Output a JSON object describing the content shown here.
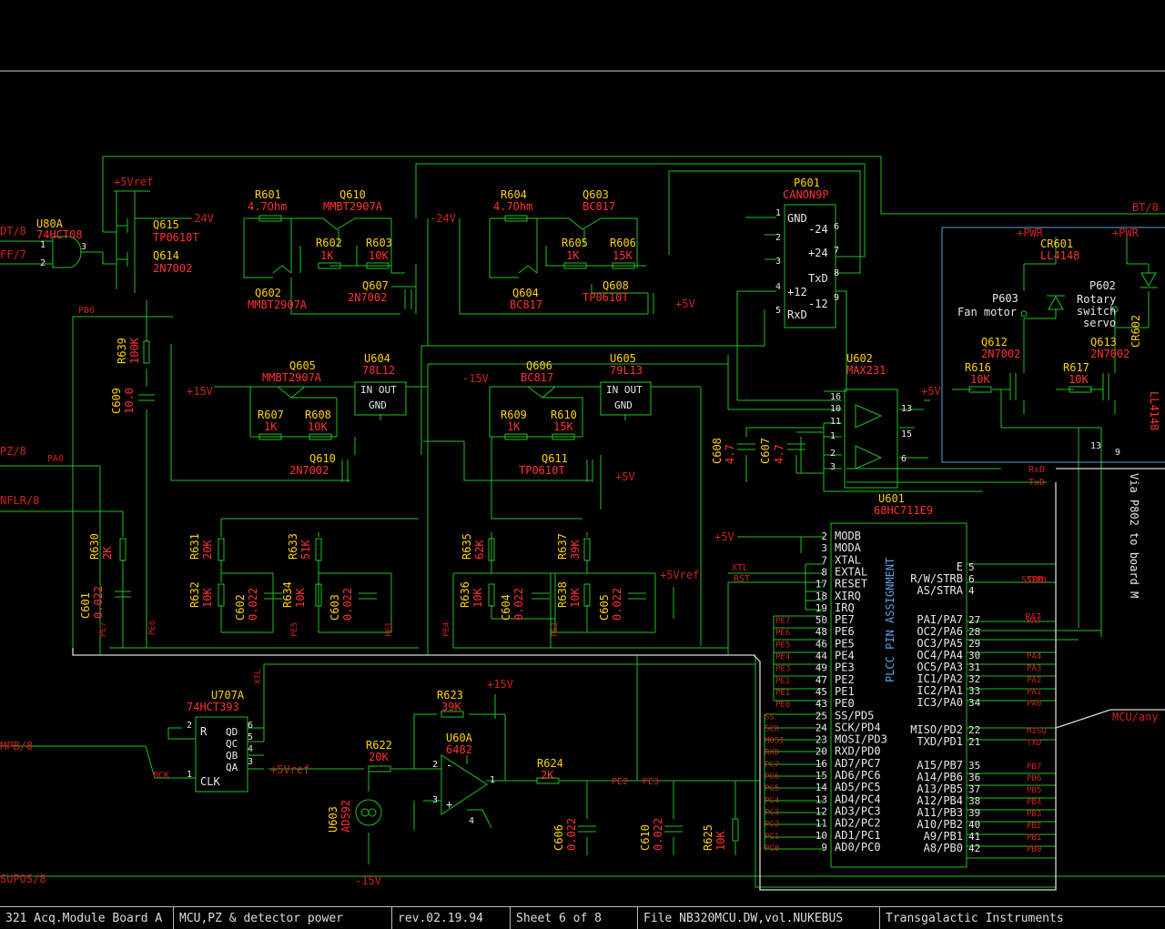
{
  "colors": {
    "wire": "#20c020",
    "ref": "#ffd000",
    "value": "#ff3030",
    "net": "#d02020",
    "text": "#e8e8e8",
    "part": "#e8e8e8",
    "blue": "#5aa0e0"
  },
  "components": [
    {
      "id": "U80A",
      "ref": "U80A",
      "value": "74HCT08"
    },
    {
      "id": "Q615",
      "ref": "Q615",
      "value": "TP0610T"
    },
    {
      "id": "Q614",
      "ref": "Q614",
      "value": "2N7002"
    },
    {
      "id": "R601",
      "ref": "R601",
      "value": "4.7Ohm"
    },
    {
      "id": "Q610a",
      "ref": "Q610",
      "value": "MMBT2907A"
    },
    {
      "id": "R602",
      "ref": "R602",
      "value": "1K"
    },
    {
      "id": "R603",
      "ref": "R603",
      "value": "10K"
    },
    {
      "id": "Q602",
      "ref": "Q602",
      "value": "MMBT2907A"
    },
    {
      "id": "Q607",
      "ref": "Q607",
      "value": "2N7002"
    },
    {
      "id": "R604",
      "ref": "R604",
      "value": "4.7Ohm"
    },
    {
      "id": "Q603",
      "ref": "Q603",
      "value": "BC817"
    },
    {
      "id": "R605",
      "ref": "R605",
      "value": "1K"
    },
    {
      "id": "R606",
      "ref": "R606",
      "value": "15K"
    },
    {
      "id": "Q604",
      "ref": "Q604",
      "value": "BC817"
    },
    {
      "id": "Q608",
      "ref": "Q608",
      "value": "TP0610T"
    },
    {
      "id": "P601",
      "ref": "P601",
      "value": "CANON9P"
    },
    {
      "id": "R639",
      "ref": "R639",
      "value": "100K"
    },
    {
      "id": "C609",
      "ref": "C609",
      "value": "10.0"
    },
    {
      "id": "Q605",
      "ref": "Q605",
      "value": "MMBT2907A"
    },
    {
      "id": "U604",
      "ref": "U604",
      "value": "78L12"
    },
    {
      "id": "R607",
      "ref": "R607",
      "value": "1K"
    },
    {
      "id": "R608",
      "ref": "R608",
      "value": "10K"
    },
    {
      "id": "Q610b",
      "ref": "Q610",
      "value": "2N7002"
    },
    {
      "id": "Q606",
      "ref": "Q606",
      "value": "BC817"
    },
    {
      "id": "U605",
      "ref": "U605",
      "value": "79L13"
    },
    {
      "id": "R609",
      "ref": "R609",
      "value": "1K"
    },
    {
      "id": "R610",
      "ref": "R610",
      "value": "15K"
    },
    {
      "id": "Q611",
      "ref": "Q611",
      "value": "TP0610T"
    },
    {
      "id": "U602",
      "ref": "U602",
      "value": "MAX231"
    },
    {
      "id": "C608",
      "ref": "C608",
      "value": "4.7"
    },
    {
      "id": "C607",
      "ref": "C607",
      "value": "4.7"
    },
    {
      "id": "U601",
      "ref": "U601",
      "value": "68HC711E9"
    },
    {
      "id": "CR601",
      "ref": "CR601",
      "value": "LL4148"
    },
    {
      "id": "CR602",
      "ref": "CR602",
      "value": "LL4148"
    },
    {
      "id": "P603",
      "ref": "P603",
      "value": ""
    },
    {
      "id": "P602",
      "ref": "P602",
      "value": ""
    },
    {
      "id": "Q612",
      "ref": "Q612",
      "value": "2N7002"
    },
    {
      "id": "Q613",
      "ref": "Q613",
      "value": "2N7002"
    },
    {
      "id": "R616",
      "ref": "R616",
      "value": "10K"
    },
    {
      "id": "R617",
      "ref": "R617",
      "value": "10K"
    },
    {
      "id": "R630",
      "ref": "R630",
      "value": "2K"
    },
    {
      "id": "C601",
      "ref": "C601",
      "value": "0.022"
    },
    {
      "id": "R631",
      "ref": "R631",
      "value": "20K"
    },
    {
      "id": "R632",
      "ref": "R632",
      "value": "10K"
    },
    {
      "id": "C602",
      "ref": "C602",
      "value": "0.022"
    },
    {
      "id": "R633",
      "ref": "R633",
      "value": "51K"
    },
    {
      "id": "R634",
      "ref": "R634",
      "value": "10K"
    },
    {
      "id": "C603",
      "ref": "C603",
      "value": "0.022"
    },
    {
      "id": "R635",
      "ref": "R635",
      "value": "62K"
    },
    {
      "id": "R636",
      "ref": "R636",
      "value": "10K"
    },
    {
      "id": "C604",
      "ref": "C604",
      "value": "0.022"
    },
    {
      "id": "R637",
      "ref": "R637",
      "value": "39K"
    },
    {
      "id": "R638",
      "ref": "R638",
      "value": "10K"
    },
    {
      "id": "C605",
      "ref": "C605",
      "value": "0.022"
    },
    {
      "id": "U707A",
      "ref": "U707A",
      "value": "74HCT393"
    },
    {
      "id": "R623",
      "ref": "R623",
      "value": "39K"
    },
    {
      "id": "U60A",
      "ref": "U60A",
      "value": "6482"
    },
    {
      "id": "R622",
      "ref": "R622",
      "value": "20K"
    },
    {
      "id": "R624",
      "ref": "R624",
      "value": "2K"
    },
    {
      "id": "U603",
      "ref": "U603",
      "value": "AD592"
    },
    {
      "id": "C606",
      "ref": "C606",
      "value": "0.022"
    },
    {
      "id": "C610",
      "ref": "C610",
      "value": "0.022"
    },
    {
      "id": "R625",
      "ref": "R625",
      "value": "10K"
    }
  ],
  "power_labels": {
    "p5vref_top": "+5Vref",
    "m24v_left": "-24V",
    "m24v_mid": "-24V",
    "p5v_q608": "+5V",
    "p15v": "+15V",
    "m15v_mid": "-15V",
    "p5v_q611": "+5V",
    "p5v_max": "+5V",
    "p5v_mcu": "+5V",
    "p5vref_bottom": "+5Vref",
    "p5vref_u60": "+5Vref",
    "p15v_u60": "+15V",
    "m15v_bottom": "-15V",
    "pwr1": "+PWR",
    "pwr2": "+PWR"
  },
  "nets": {
    "dt8": "DT/8",
    "ff7": "FF/7",
    "pb6": "PB6",
    "pz8": "PZ/8",
    "pa0": "PA0",
    "nflr8": "NFLR/8",
    "mpb8": "MPB/8",
    "supos8": "SUPOS/8",
    "bt8": "BT/8",
    "mcuany": "MCU/any",
    "rxd": "RxD",
    "txd": "TxD",
    "xtl": "XTL",
    "rst": "RST",
    "strb": "STRB",
    "pa7": "PA7",
    "bck": "BCK",
    "pe7": "PE7",
    "pe6": "PE6",
    "pe5": "PE5",
    "pe1": "PE1",
    "pe4": "PE4",
    "pe3b": "PE3",
    "pe2b": "PE2",
    "pe3": "PE3",
    "via": "Via P802 to board M"
  },
  "p601_pins": {
    "gnd": "GND",
    "m24": "-24",
    "p24": "+24",
    "txd": "TxD",
    "p12": "+12",
    "m12": "-12",
    "rxd": "RxD"
  },
  "p603_text": {
    "label": "Fan motor"
  },
  "p602_text": {
    "l1": "Rotary",
    "l2": "switch",
    "l3": "servo"
  },
  "reg_text": {
    "inout": "IN OUT",
    "gnd": "GND"
  },
  "u707_pins": {
    "r": "R",
    "qd": "QD",
    "qc": "QC",
    "qb": "QB",
    "qa": "QA",
    "clk": "CLK"
  },
  "mcu": {
    "title": "PLCC PIN ASSIGNMENT",
    "left_pins": [
      {
        "num": "2",
        "name": "MODB",
        "net": ""
      },
      {
        "num": "3",
        "name": "MODA",
        "net": ""
      },
      {
        "num": "7",
        "name": "XTAL",
        "net": ""
      },
      {
        "num": "8",
        "name": "EXTAL",
        "net": ""
      },
      {
        "num": "17",
        "name": "RESET",
        "net": ""
      },
      {
        "num": "18",
        "name": "XIRQ",
        "net": ""
      },
      {
        "num": "19",
        "name": "IRQ",
        "net": ""
      },
      {
        "num": "50",
        "name": "PE7",
        "net": "PE7"
      },
      {
        "num": "48",
        "name": "PE6",
        "net": "PE6"
      },
      {
        "num": "46",
        "name": "PE5",
        "net": "PE5"
      },
      {
        "num": "44",
        "name": "PE4",
        "net": "PE4"
      },
      {
        "num": "49",
        "name": "PE3",
        "net": "PE3"
      },
      {
        "num": "47",
        "name": "PE2",
        "net": "PE2"
      },
      {
        "num": "45",
        "name": "PE1",
        "net": "PE1"
      },
      {
        "num": "43",
        "name": "PE0",
        "net": "PE0"
      },
      {
        "num": "25",
        "name": "SS/PD5",
        "net": "SS"
      },
      {
        "num": "24",
        "name": "SCK/PD4",
        "net": "SCK"
      },
      {
        "num": "23",
        "name": "MOSI/PD3",
        "net": "MOSI"
      },
      {
        "num": "20",
        "name": "RXD/PD0",
        "net": "RXD"
      },
      {
        "num": "16",
        "name": "AD7/PC7",
        "net": "PC7"
      },
      {
        "num": "15",
        "name": "AD6/PC6",
        "net": "PC6"
      },
      {
        "num": "14",
        "name": "AD5/PC5",
        "net": "PC5"
      },
      {
        "num": "13",
        "name": "AD4/PC4",
        "net": "PC4"
      },
      {
        "num": "12",
        "name": "AD3/PC3",
        "net": "PC3"
      },
      {
        "num": "11",
        "name": "AD2/PC2",
        "net": "PC2"
      },
      {
        "num": "10",
        "name": "AD1/PC1",
        "net": "PC1"
      },
      {
        "num": "9",
        "name": "AD0/PC0",
        "net": "PC0"
      }
    ],
    "right_pins": [
      {
        "num": "5",
        "name": "E",
        "net": ""
      },
      {
        "num": "6",
        "name": "R/W/STRB",
        "net": "STRB"
      },
      {
        "num": "4",
        "name": "AS/STRA",
        "net": ""
      },
      {
        "num": "27",
        "name": "PAI/PA7",
        "net": "PA7"
      },
      {
        "num": "28",
        "name": "OC2/PA6",
        "net": ""
      },
      {
        "num": "29",
        "name": "OC3/PA5",
        "net": ""
      },
      {
        "num": "30",
        "name": "OC4/PA4",
        "net": "PA4"
      },
      {
        "num": "31",
        "name": "OC5/PA3",
        "net": "PA3"
      },
      {
        "num": "32",
        "name": "IC1/PA2",
        "net": "PA2"
      },
      {
        "num": "33",
        "name": "IC2/PA1",
        "net": "PA1"
      },
      {
        "num": "34",
        "name": "IC3/PA0",
        "net": "PA0"
      },
      {
        "num": "22",
        "name": "MISO/PD2",
        "net": "MISO"
      },
      {
        "num": "21",
        "name": "TXD/PD1",
        "net": "TXD"
      },
      {
        "num": "35",
        "name": "A15/PB7",
        "net": "PB7"
      },
      {
        "num": "36",
        "name": "A14/PB6",
        "net": "PB6"
      },
      {
        "num": "37",
        "name": "A13/PB5",
        "net": "PB5"
      },
      {
        "num": "38",
        "name": "A12/PB4",
        "net": "PB4"
      },
      {
        "num": "39",
        "name": "A11/PB3",
        "net": "PB3"
      },
      {
        "num": "40",
        "name": "A10/PB2",
        "net": "PB2"
      },
      {
        "num": "41",
        "name": "A9/PB1",
        "net": "PB1"
      },
      {
        "num": "42",
        "name": "A8/PB0",
        "net": "PB0"
      }
    ]
  },
  "titleblock": [
    "321 Acq.Module Board A",
    "MCU,PZ & detector power",
    "rev.02.19.94",
    "Sheet 6 of 8",
    "File NB320MCU.DW,vol.NUKEBUS",
    "Transgalactic Instruments"
  ]
}
